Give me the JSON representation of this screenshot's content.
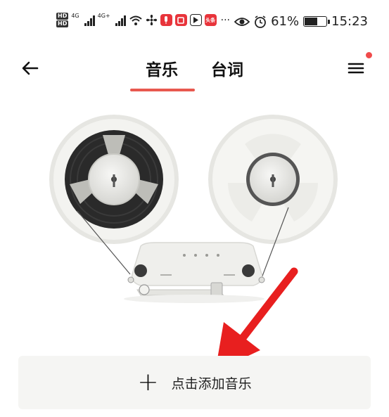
{
  "status_bar": {
    "hd_top": "HD",
    "hd_bottom": "HD",
    "sig1_label": "4G",
    "sig2_label": "4G+",
    "ellipsis": "···",
    "battery_percent": "61%",
    "battery_level": 0.61,
    "time": "15:23",
    "toutiao_label": "头条"
  },
  "header": {
    "tabs": [
      {
        "label": "音乐",
        "active": true
      },
      {
        "label": "台词",
        "active": false
      }
    ],
    "accent_color": "#e8584f"
  },
  "add_music": {
    "plus": "+",
    "label": "点击添加音乐"
  }
}
